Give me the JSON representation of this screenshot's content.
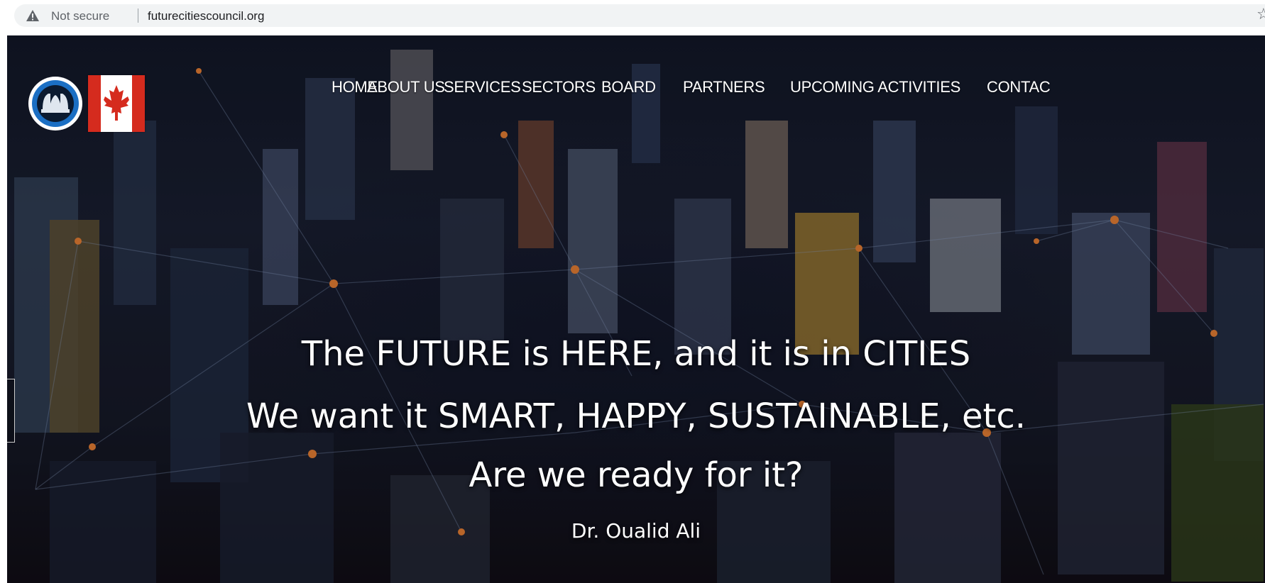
{
  "browser": {
    "security_icon": "warning-triangle-icon",
    "security_label": "Not secure",
    "url": "futurecitiescouncil.org",
    "bookmark_icon": "star-outline-icon",
    "bookmark_glyph": "☆"
  },
  "site": {
    "logo_icon": "council-hands-logo-icon",
    "flag_icon": "canadian-flag-icon",
    "nav": [
      {
        "label": "HOME"
      },
      {
        "label": "ABOUT US"
      },
      {
        "label": "SERVICES"
      },
      {
        "label": "SECTORS"
      },
      {
        "label": "BOARD"
      },
      {
        "label": "PARTNERS"
      },
      {
        "label": "UPCOMING ACTIVITIES"
      },
      {
        "label": "CONTAC"
      }
    ]
  },
  "hero": {
    "line1": "The FUTURE is HERE, and it is in CITIES",
    "line2": "We want it SMART, HAPPY, SUSTAINABLE, etc.",
    "line3": "Are we ready for it?",
    "author": "Dr. Oualid Ali"
  },
  "colors": {
    "nav_text": "#ffffff",
    "logo_blue": "#1b6fc4",
    "flag_red": "#d52b1e",
    "omnibox_bg": "#f1f3f4"
  }
}
